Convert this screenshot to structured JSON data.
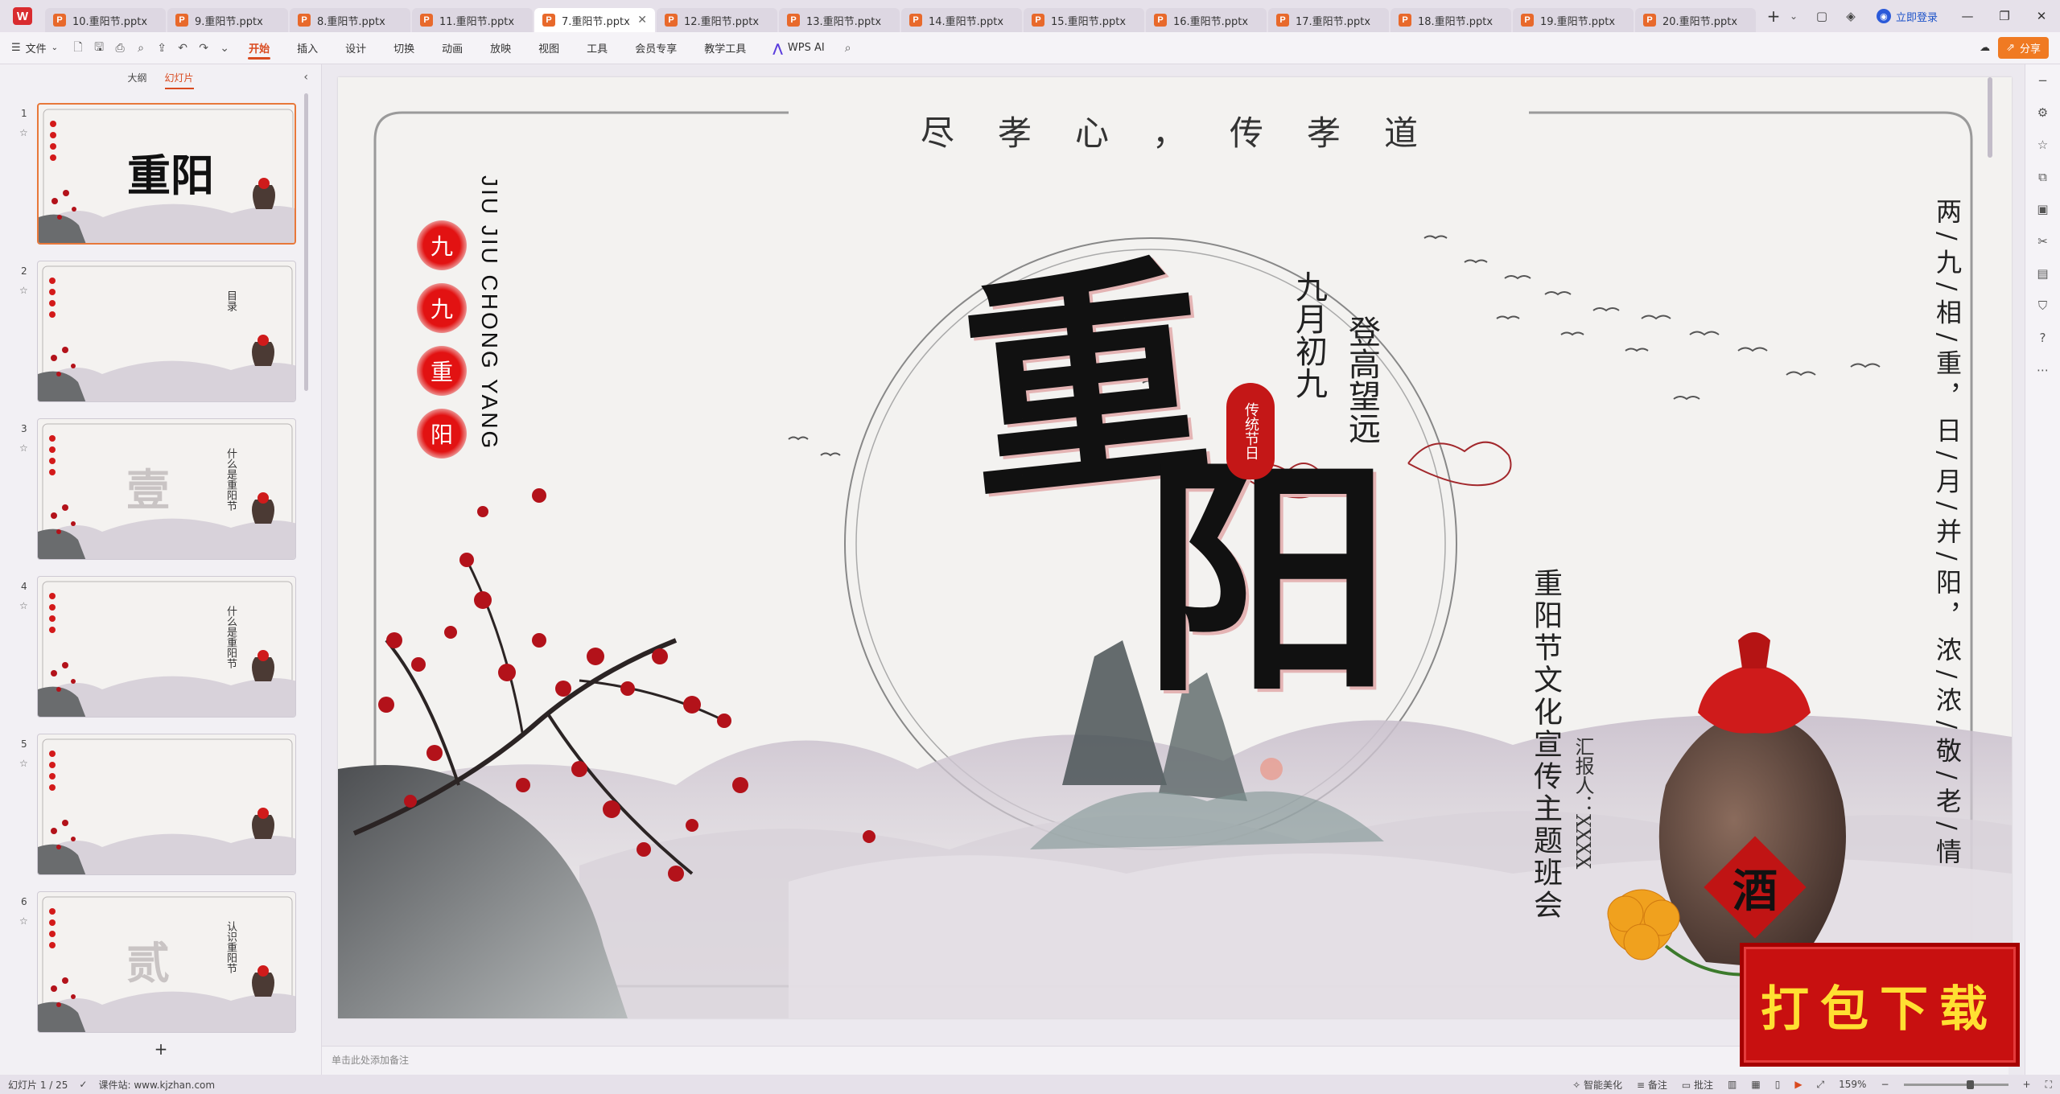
{
  "tabs": [
    {
      "label": "10.重阳节.pptx",
      "active": false
    },
    {
      "label": "9.重阳节.pptx",
      "active": false
    },
    {
      "label": "8.重阳节.pptx",
      "active": false
    },
    {
      "label": "11.重阳节.pptx",
      "active": false
    },
    {
      "label": "7.重阳节.pptx",
      "active": true
    },
    {
      "label": "12.重阳节.pptx",
      "active": false
    },
    {
      "label": "13.重阳节.pptx",
      "active": false
    },
    {
      "label": "14.重阳节.pptx",
      "active": false
    },
    {
      "label": "15.重阳节.pptx",
      "active": false
    },
    {
      "label": "16.重阳节.pptx",
      "active": false
    },
    {
      "label": "17.重阳节.pptx",
      "active": false
    },
    {
      "label": "18.重阳节.pptx",
      "active": false
    },
    {
      "label": "19.重阳节.pptx",
      "active": false
    },
    {
      "label": "20.重阳节.pptx",
      "active": false
    }
  ],
  "tab_icon_letter": "P",
  "login_label": "立即登录",
  "ribbon": {
    "file_label": "文件",
    "tabs": [
      "开始",
      "插入",
      "设计",
      "切换",
      "动画",
      "放映",
      "视图",
      "工具",
      "会员专享",
      "教学工具"
    ],
    "active_tab": "开始",
    "wps_ai_label": "WPS AI",
    "share_label": "分享"
  },
  "left_panel": {
    "tab_outline": "大纲",
    "tab_slides": "幻灯片",
    "active": "幻灯片",
    "thumbnails": [
      {
        "num": "1",
        "active": true,
        "big": "重阳",
        "caption": ""
      },
      {
        "num": "2",
        "active": false,
        "big": "",
        "caption": "目录"
      },
      {
        "num": "3",
        "active": false,
        "big": "壹",
        "caption": "什么是重阳节"
      },
      {
        "num": "4",
        "active": false,
        "big": "",
        "caption": "什么是重阳节"
      },
      {
        "num": "5",
        "active": false,
        "big": "",
        "caption": ""
      },
      {
        "num": "6",
        "active": false,
        "big": "贰",
        "caption": "认识重阳节"
      }
    ],
    "add_slide": "+"
  },
  "slide": {
    "top_title": "尽孝心，传孝道",
    "red_dots": [
      "九",
      "九",
      "重",
      "阳"
    ],
    "pinyin": "JIU JIU CHONG YANG",
    "big_chong": "重",
    "big_yang": "阳",
    "date_text": "九月初九",
    "motto_text": "登高望远",
    "stamp_text": "传统节日",
    "subtitle": "重阳节文化宣传主题班会",
    "reporter": "汇报人：XXXX",
    "poem": "两/九/相/重，日/月/并/阳，浓/浓/敬/老/情",
    "jar_label": "酒"
  },
  "download_badge": "打包下载",
  "notes_placeholder": "单击此处添加备注",
  "status": {
    "slide_counter": "幻灯片 1 / 25",
    "site": "课件站: www.kjzhan.com",
    "beautify": "智能美化",
    "notes": "备注",
    "comments": "批注",
    "zoom": "159%"
  },
  "colors": {
    "accent": "#d94a1f",
    "brand_red": "#d92b2f",
    "seal_red": "#c41717",
    "badge_text": "#ffe032"
  },
  "icons": [
    "wps-logo-icon",
    "new-tab-icon",
    "search-icon",
    "minimize-icon",
    "maximize-icon",
    "close-icon",
    "plus-icon",
    "star-icon",
    "share-icon"
  ]
}
